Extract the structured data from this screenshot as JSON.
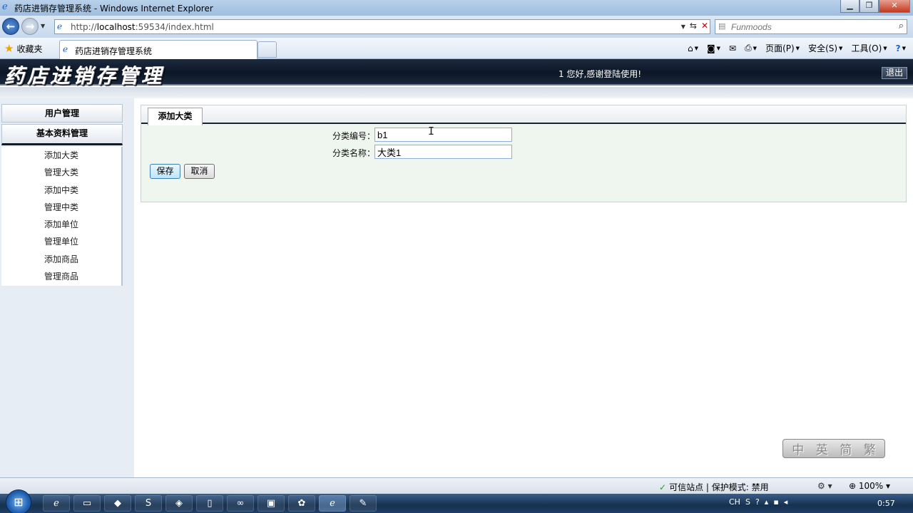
{
  "window": {
    "title": "药店进销存管理系统 - Windows Internet Explorer",
    "buttons": [
      "▁",
      "❐",
      "✕"
    ]
  },
  "browser": {
    "url_prefix": "http://",
    "url_host": "localhost",
    "url_rest": ":59534/index.html",
    "search_placeholder": "Funmoods",
    "favorites_label": "收藏夹",
    "tab_title": "药店进销存管理系统",
    "commands": {
      "page": "页面(P)",
      "safety": "安全(S)",
      "tools": "工具(O)"
    }
  },
  "app": {
    "logo": "药店进销存管理",
    "welcome": "1 您好,感谢登陆使用!",
    "logout": "退出",
    "sidebar": {
      "header_1": "用户管理",
      "header_2": "基本资料管理",
      "items": [
        "添加大类",
        "管理大类",
        "添加中类",
        "管理中类",
        "添加单位",
        "管理单位",
        "添加商品",
        "管理商品"
      ]
    },
    "panel": {
      "tab": "添加大类",
      "code_label": "分类编号：",
      "code_value": "b1",
      "name_label": "分类名称：",
      "name_value": "大类1",
      "save": "保存",
      "cancel": "取消"
    },
    "lang_widget": [
      "中",
      "英",
      "简",
      "繁"
    ]
  },
  "status": {
    "zone": "可信站点 | 保护模式: 禁用",
    "zoom": "100%"
  },
  "taskbar": {
    "tray_lang": "CH",
    "clock": "0:57"
  },
  "colors": {
    "header_bg": "#0c1626",
    "sidebar_bg": "#e7edf5",
    "panel_bg": "#eff6f0",
    "ie_blue": "#1d64c8"
  }
}
